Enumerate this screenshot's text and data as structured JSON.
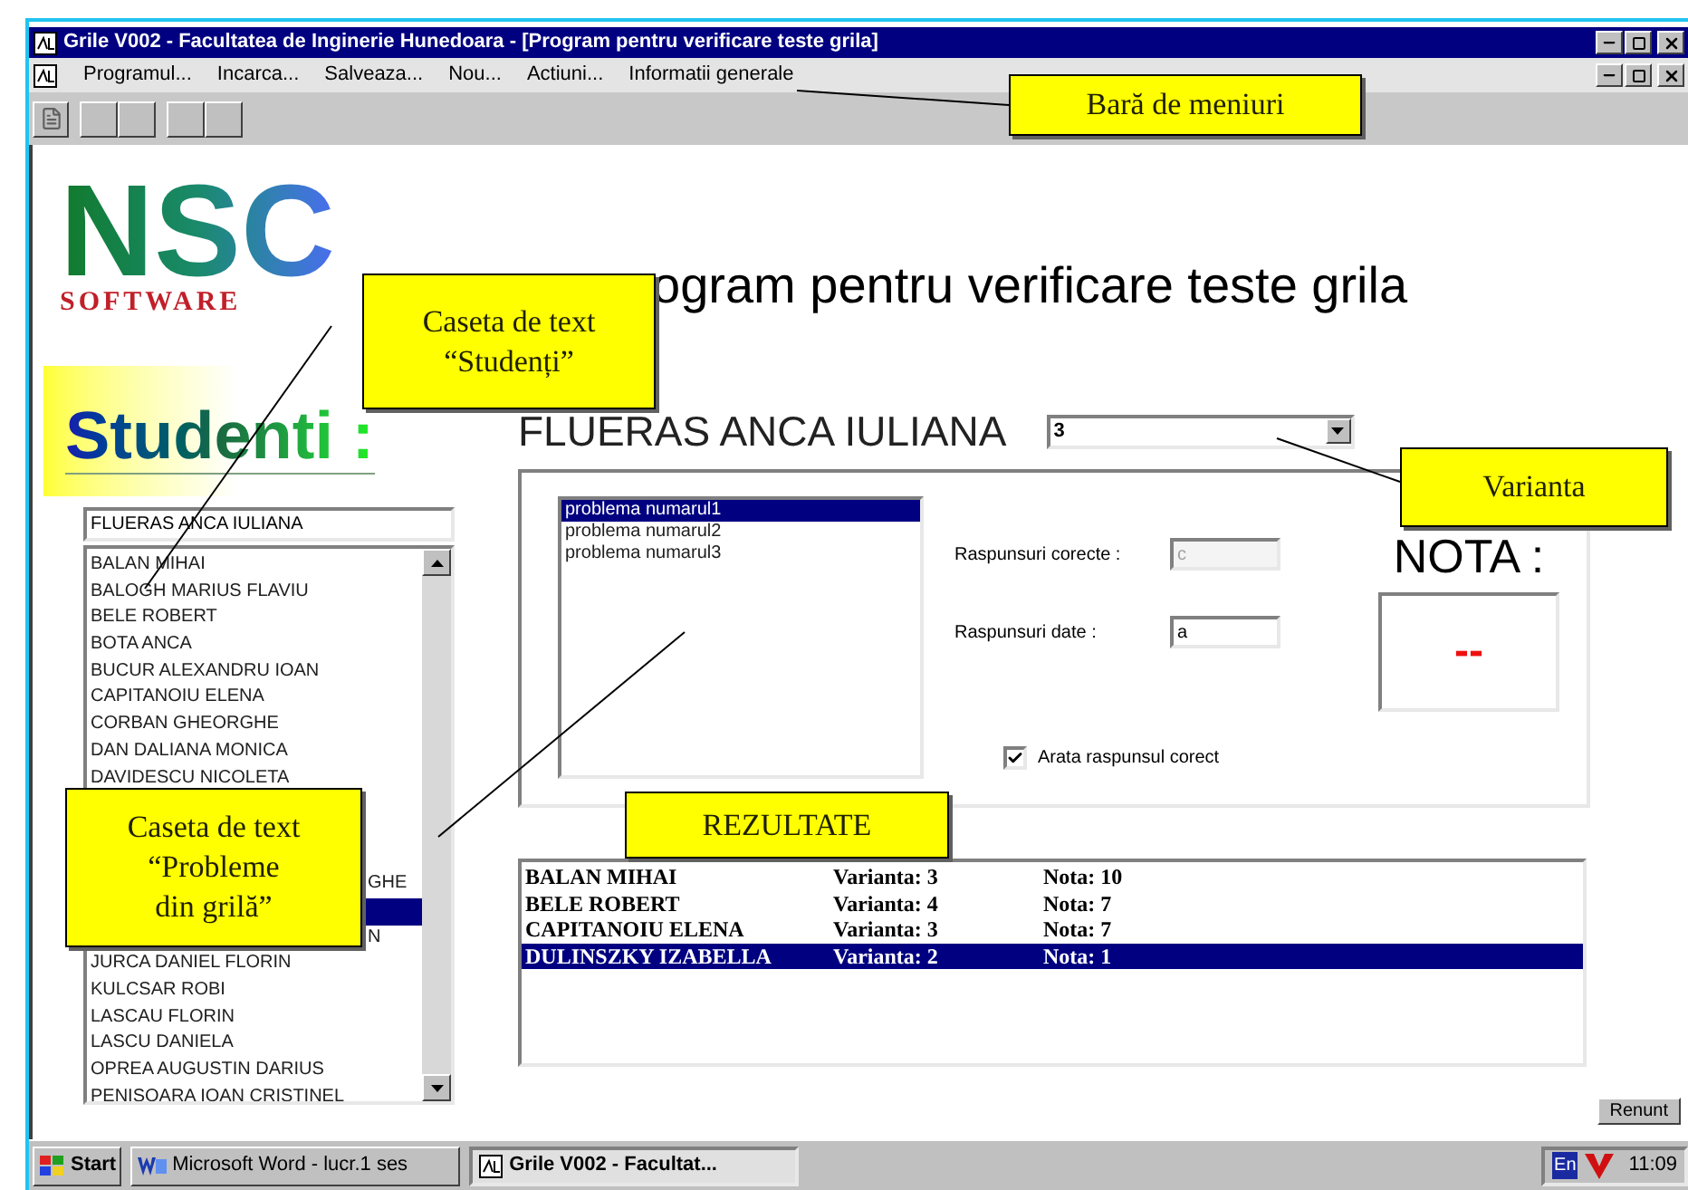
{
  "window": {
    "title": "Grile V002 - Facultatea de Inginerie Hunedoara - [Program pentru verificare teste grila]"
  },
  "menu": [
    "Programul...",
    "Incarca...",
    "Salveaza...",
    "Nou...",
    "Actiuni...",
    "Informatii generale"
  ],
  "logo": {
    "letters": "NSC",
    "tagline": "SOFTWARE"
  },
  "heading": "ogram pentru verificare teste grila",
  "students": {
    "title": "Studenti :",
    "current": "FLUERAS ANCA IULIANA",
    "items": [
      {
        "kind": "full",
        "text": "BALAN MIHAI",
        "selected": false
      },
      {
        "kind": "full",
        "text": "BALOGH MARIUS FLAVIU",
        "selected": false
      },
      {
        "kind": "full",
        "text": "BELE ROBERT",
        "selected": false
      },
      {
        "kind": "full",
        "text": "BOTA ANCA",
        "selected": false
      },
      {
        "kind": "full",
        "text": "BUCUR ALEXANDRU IOAN",
        "selected": false
      },
      {
        "kind": "full",
        "text": "CAPITANOIU ELENA",
        "selected": false
      },
      {
        "kind": "full",
        "text": "CORBAN GHEORGHE",
        "selected": false
      },
      {
        "kind": "full",
        "text": "DAN DALIANA MONICA",
        "selected": false
      },
      {
        "kind": "full",
        "text": "DAVIDESCU NICOLETA",
        "selected": false
      },
      {
        "kind": "hidden",
        "selected": false
      },
      {
        "kind": "hidden",
        "selected": false
      },
      {
        "kind": "hidden",
        "selected": false
      },
      {
        "kind": "partial",
        "text": "GHE",
        "selected": false
      },
      {
        "kind": "hidden",
        "selected": true
      },
      {
        "kind": "partial",
        "text": "N",
        "selected": false
      },
      {
        "kind": "full",
        "text": "JURCA DANIEL FLORIN",
        "selected": false
      },
      {
        "kind": "full",
        "text": "KULCSAR ROBI",
        "selected": false
      },
      {
        "kind": "full",
        "text": "LASCAU FLORIN",
        "selected": false
      },
      {
        "kind": "full",
        "text": "LASCU DANIELA",
        "selected": false
      },
      {
        "kind": "full",
        "text": "OPREA AUGUSTIN DARIUS",
        "selected": false
      },
      {
        "kind": "full",
        "text": "PENISOARA IOAN CRISTINEL",
        "selected": false
      }
    ]
  },
  "student_name": "FLUERAS ANCA IULIANA",
  "variant": {
    "value": "3"
  },
  "problems": [
    {
      "text": "problema numarul1",
      "selected": true
    },
    {
      "text": "problema numarul2",
      "selected": false
    },
    {
      "text": "problema numarul3",
      "selected": false
    }
  ],
  "answers": {
    "correct_label": "Raspunsuri corecte :",
    "correct_value": "c",
    "correct_disabled": true,
    "given_label": "Raspunsuri date :",
    "given_value": "a"
  },
  "grade": {
    "label": "NOTA :",
    "value": "--"
  },
  "show_correct": {
    "label": "Arata raspunsul corect",
    "checked": true
  },
  "results": [
    {
      "name": "BALAN MIHAI",
      "variant": "Varianta: 3",
      "grade": "Nota: 10",
      "selected": false
    },
    {
      "name": "BELE ROBERT",
      "variant": "Varianta: 4",
      "grade": "Nota: 7",
      "selected": false
    },
    {
      "name": "CAPITANOIU ELENA",
      "variant": "Varianta: 3",
      "grade": "Nota: 7",
      "selected": false
    },
    {
      "name": "DULINSZKY IZABELLA",
      "variant": "Varianta: 2",
      "grade": "Nota: 1",
      "selected": true
    }
  ],
  "cancel_button": "Renunt",
  "taskbar": {
    "start": "Start",
    "tasks": [
      {
        "kind": "word",
        "label": "Microsoft Word - lucr.1 ses",
        "active": false
      },
      {
        "kind": "app",
        "label": "Grile V002 - Facultat...",
        "active": true
      }
    ],
    "language": "En",
    "clock": "11:09"
  },
  "callouts": [
    {
      "text": "Bară de meniuri"
    },
    {
      "text": "Caseta de text\n“Studenți”"
    },
    {
      "text": "Varianta"
    },
    {
      "text": "Caseta de text\n“Probleme\ndin grilă”"
    },
    {
      "text": "REZULTATE"
    }
  ]
}
